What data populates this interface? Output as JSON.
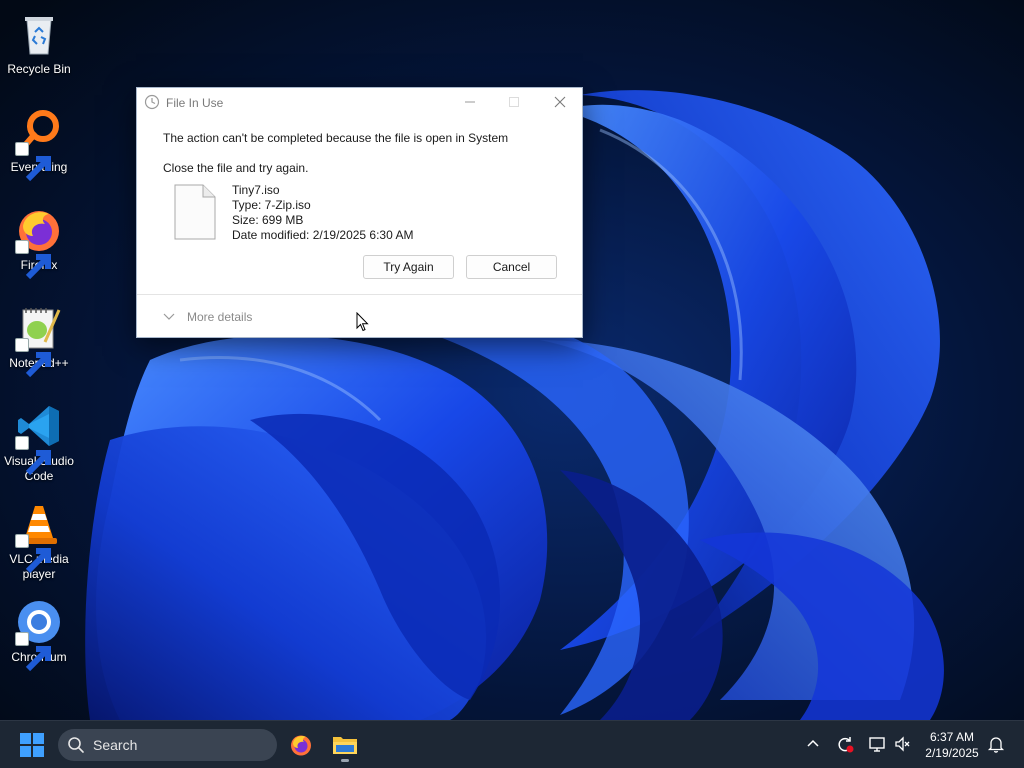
{
  "desktop": {
    "icons": [
      {
        "label": "Recycle Bin",
        "icon": "recycle-bin-icon"
      },
      {
        "label": "Everything",
        "icon": "everything-search-icon"
      },
      {
        "label": "Firefox",
        "icon": "firefox-icon"
      },
      {
        "label": "Notepad++",
        "icon": "notepad-plus-plus-icon"
      },
      {
        "label": "Visual Studio Code",
        "icon": "vscode-icon"
      },
      {
        "label": "VLC media player",
        "icon": "vlc-icon"
      },
      {
        "label": "Chromium",
        "icon": "chromium-icon"
      }
    ]
  },
  "dialog": {
    "title": "File In Use",
    "message": "The action can't be completed because the file is open in System",
    "instruction": "Close the file and try again.",
    "file": {
      "name": "Tiny7.iso",
      "type": "Type: 7-Zip.iso",
      "size": "Size: 699 MB",
      "modified": "Date modified: 2/19/2025 6:30 AM"
    },
    "try_again_label": "Try Again",
    "cancel_label": "Cancel",
    "more_details_label": "More details"
  },
  "taskbar": {
    "search_placeholder": "Search",
    "pinned": [
      "firefox-icon",
      "file-explorer-icon"
    ],
    "tray": [
      "chevron-up-icon",
      "sync-icon",
      "network-icon",
      "volume-muted-icon"
    ],
    "clock": {
      "time": "6:37 AM",
      "date": "2/19/2025"
    }
  },
  "colors": {
    "accent_blue": "#1d5cff",
    "taskbar_bg": "#1d2734",
    "wallpaper_dark": "#020915"
  }
}
